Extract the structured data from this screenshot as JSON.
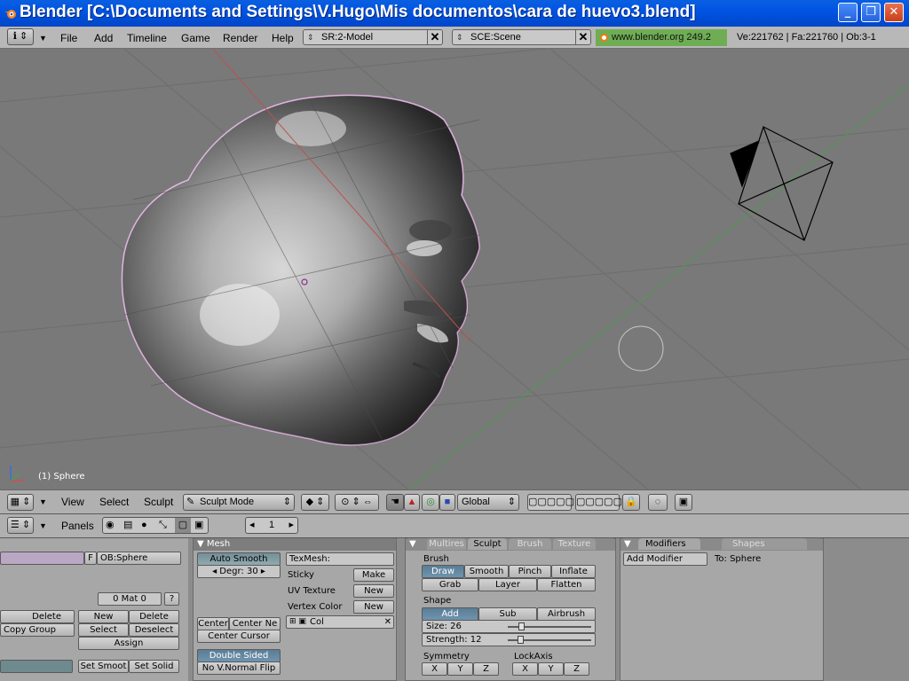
{
  "window": {
    "title": "Blender [C:\\Documents and Settings\\V.Hugo\\Mis documentos\\cara de huevo3.blend]",
    "min": "_",
    "max": "❐",
    "close": "✕"
  },
  "menubar": {
    "items": [
      "File",
      "Add",
      "Timeline",
      "Game",
      "Render",
      "Help"
    ],
    "screen": "SR:2-Model",
    "scene": "SCE:Scene",
    "version": "www.blender.org 249.2",
    "stats": "Ve:221762 | Fa:221760 | Ob:3-1"
  },
  "viewport": {
    "object_label": "(1) Sphere"
  },
  "vp_header": {
    "menus": [
      "View",
      "Select",
      "Sculpt"
    ],
    "mode": "Sculpt Mode",
    "orientation": "Global"
  },
  "btn_header": {
    "panels_label": "Panels",
    "frame": "1"
  },
  "link_panel": {
    "ob_field": "OB:Sphere",
    "f_label": "F",
    "mat": "0 Mat 0",
    "q": "?",
    "delete1": "Delete",
    "copy_group": "Copy Group",
    "new": "New",
    "delete2": "Delete",
    "select": "Select",
    "deselect": "Deselect",
    "assign": "Assign",
    "set_smooth": "Set Smoot",
    "set_solid": "Set Solid"
  },
  "mesh_panel": {
    "title": "Mesh",
    "auto_smooth": "Auto Smooth",
    "degr": "Degr: 30",
    "texmesh": "TexMesh:",
    "sticky": "Sticky",
    "make": "Make",
    "uv_texture": "UV Texture",
    "new1": "New",
    "vertex_col": "Vertex Color",
    "new2": "New",
    "center": "Center",
    "center_new": "Center Ne",
    "center_cursor": "Center Cursor",
    "col": "Col",
    "double_sided": "Double Sided",
    "no_vnormal": "No V.Normal Flip"
  },
  "sculpt_panel": {
    "tabs": [
      "Multires",
      "Sculpt",
      "Brush",
      "Texture"
    ],
    "brush_label": "Brush",
    "brushes": [
      "Draw",
      "Smooth",
      "Pinch",
      "Inflate",
      "Grab",
      "Layer",
      "Flatten"
    ],
    "shape_label": "Shape",
    "shape_btns": [
      "Add",
      "Sub",
      "Airbrush"
    ],
    "size": "Size: 26",
    "strength": "Strength: 12",
    "size_value": 26,
    "strength_value": 12,
    "symmetry_label": "Symmetry",
    "lockaxis_label": "LockAxis",
    "sym_axes": [
      "X",
      "Y",
      "Z"
    ],
    "lock_axes": [
      "X",
      "Y",
      "Z"
    ]
  },
  "modifiers_panel": {
    "tabs": [
      "Modifiers",
      "Shapes"
    ],
    "add_modifier": "Add Modifier",
    "to": "To: Sphere"
  }
}
